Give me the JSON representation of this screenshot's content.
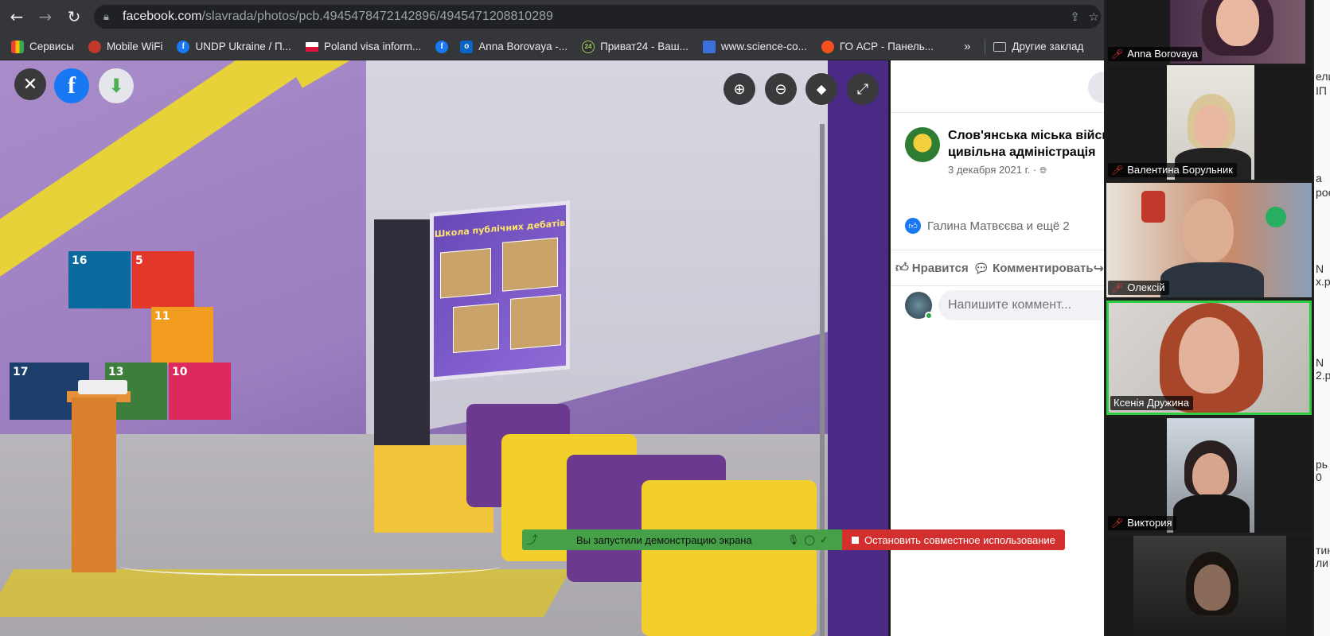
{
  "browser": {
    "url_domain": "facebook.com",
    "url_path": "/slavrada/photos/pcb.4945478472142896/4945471208810289",
    "bookmarks": [
      {
        "label": "Сервисы",
        "icon": "apps-grid-icon"
      },
      {
        "label": "Mobile WiFi",
        "icon": "wifi-router-icon"
      },
      {
        "label": "UNDP Ukraine / П...",
        "icon": "facebook-icon"
      },
      {
        "label": "Poland visa inform...",
        "icon": "poland-flag-icon"
      },
      {
        "label": "",
        "icon": "facebook-icon"
      },
      {
        "label": "Anna Borovaya -...",
        "icon": "outlook-icon"
      },
      {
        "label": "Приват24 - Ваш...",
        "icon": "privat24-icon"
      },
      {
        "label": "www.science-co...",
        "icon": "science-icon"
      },
      {
        "label": "ГО АСР - Панель...",
        "icon": "joomla-icon"
      }
    ],
    "more": "»",
    "other_bookmarks": "Другие заклад"
  },
  "photo": {
    "screen_title": "Школа публічних дебатів",
    "cubes": [
      "16",
      "5",
      "17",
      "11",
      "13",
      "10"
    ]
  },
  "post": {
    "page_name_line1": "Слов'янська міська війсь",
    "page_name_line2": "цивільна адміністрація",
    "date": "3 декабря 2021 г. ·",
    "reactions": "Галина Матвєєва и ещё 2",
    "like_label": "Нравится",
    "comment_label": "Комментировать",
    "share_label": "По",
    "comment_placeholder": "Напишите коммент..."
  },
  "share_notice": {
    "message": "Вы запустили демонстрацию экрана",
    "stop_label": "Остановить совместное использование"
  },
  "participants": [
    {
      "name": "Anna Borovaya",
      "muted": true
    },
    {
      "name": "Валентина Борульник",
      "muted": true
    },
    {
      "name": "Олексій",
      "muted": true
    },
    {
      "name": "Ксенія Дружина",
      "muted": false
    },
    {
      "name": "Виктория",
      "muted": true
    },
    {
      "name": "",
      "muted": false
    }
  ],
  "edge_text": [
    "ели",
    "ІП",
    "а",
    "рое",
    "N",
    "х.р",
    "N",
    "2.р",
    "рь",
    "0",
    "тин",
    "ли"
  ],
  "colors": {
    "facebook_blue": "#1877f2",
    "share_green": "#45a048",
    "stop_red": "#d32f2f",
    "active_speaker": "#2ecc40"
  }
}
